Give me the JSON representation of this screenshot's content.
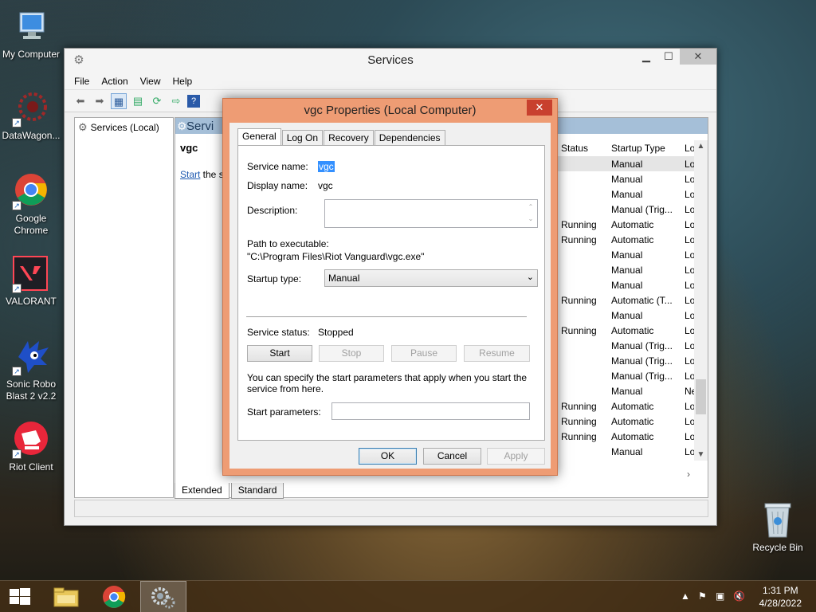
{
  "desktop": {
    "icons": [
      {
        "label": "My Computer"
      },
      {
        "label": "DataWagon..."
      },
      {
        "label": "Google Chrome"
      },
      {
        "label": "VALORANT"
      },
      {
        "label": "Sonic Robo Blast 2 v2.2"
      },
      {
        "label": "Riot Client"
      }
    ],
    "recycle_bin": "Recycle Bin"
  },
  "services_window": {
    "title": "Services",
    "menu": [
      "File",
      "Action",
      "View",
      "Help"
    ],
    "tree_node": "Services (Local)",
    "header_label": "Servi",
    "selected_service": "vgc",
    "start_link": "Start",
    "start_suffix": " the se",
    "columns": {
      "status": "Status",
      "startup_type": "Startup Type",
      "log_on": "Lo"
    },
    "rows": [
      {
        "status": "",
        "startup": "Manual",
        "log": "Lo"
      },
      {
        "status": "",
        "startup": "Manual",
        "log": "Lo"
      },
      {
        "status": "",
        "startup": "Manual",
        "log": "Lo"
      },
      {
        "status": "",
        "startup": "Manual (Trig...",
        "log": "Lo"
      },
      {
        "status": "Running",
        "startup": "Automatic",
        "log": "Lo"
      },
      {
        "status": "Running",
        "startup": "Automatic",
        "log": "Lo"
      },
      {
        "status": "",
        "startup": "Manual",
        "log": "Lo"
      },
      {
        "status": "",
        "startup": "Manual",
        "log": "Lo"
      },
      {
        "status": "",
        "startup": "Manual",
        "log": "Lo"
      },
      {
        "status": "Running",
        "startup": "Automatic (T...",
        "log": "Lo"
      },
      {
        "status": "",
        "startup": "Manual",
        "log": "Lo"
      },
      {
        "status": "Running",
        "startup": "Automatic",
        "log": "Lo"
      },
      {
        "status": "",
        "startup": "Manual (Trig...",
        "log": "Lo"
      },
      {
        "status": "",
        "startup": "Manual (Trig...",
        "log": "Lo"
      },
      {
        "status": "",
        "startup": "Manual (Trig...",
        "log": "Lo"
      },
      {
        "status": "",
        "startup": "Manual",
        "log": "Ne"
      },
      {
        "status": "Running",
        "startup": "Automatic",
        "log": "Lo"
      },
      {
        "status": "Running",
        "startup": "Automatic",
        "log": "Lo"
      },
      {
        "status": "Running",
        "startup": "Automatic",
        "log": "Lo"
      },
      {
        "status": "",
        "startup": "Manual",
        "log": "Lo"
      }
    ],
    "view_tabs": [
      "Extended",
      "Standard"
    ]
  },
  "dialog": {
    "title": "vgc Properties (Local Computer)",
    "tabs": [
      "General",
      "Log On",
      "Recovery",
      "Dependencies"
    ],
    "service_name_label": "Service name:",
    "service_name": "vgc",
    "display_name_label": "Display name:",
    "display_name": "vgc",
    "description_label": "Description:",
    "path_label": "Path to executable:",
    "path": "\"C:\\Program Files\\Riot Vanguard\\vgc.exe\"",
    "startup_type_label": "Startup type:",
    "startup_type": "Manual",
    "service_status_label": "Service status:",
    "service_status": "Stopped",
    "buttons": {
      "start": "Start",
      "stop": "Stop",
      "pause": "Pause",
      "resume": "Resume"
    },
    "param_hint": "You can specify the start parameters that apply when you start the service from here.",
    "start_params_label": "Start parameters:",
    "ok": "OK",
    "cancel": "Cancel",
    "apply": "Apply"
  },
  "taskbar": {
    "time": "1:31 PM",
    "date": "4/28/2022"
  }
}
